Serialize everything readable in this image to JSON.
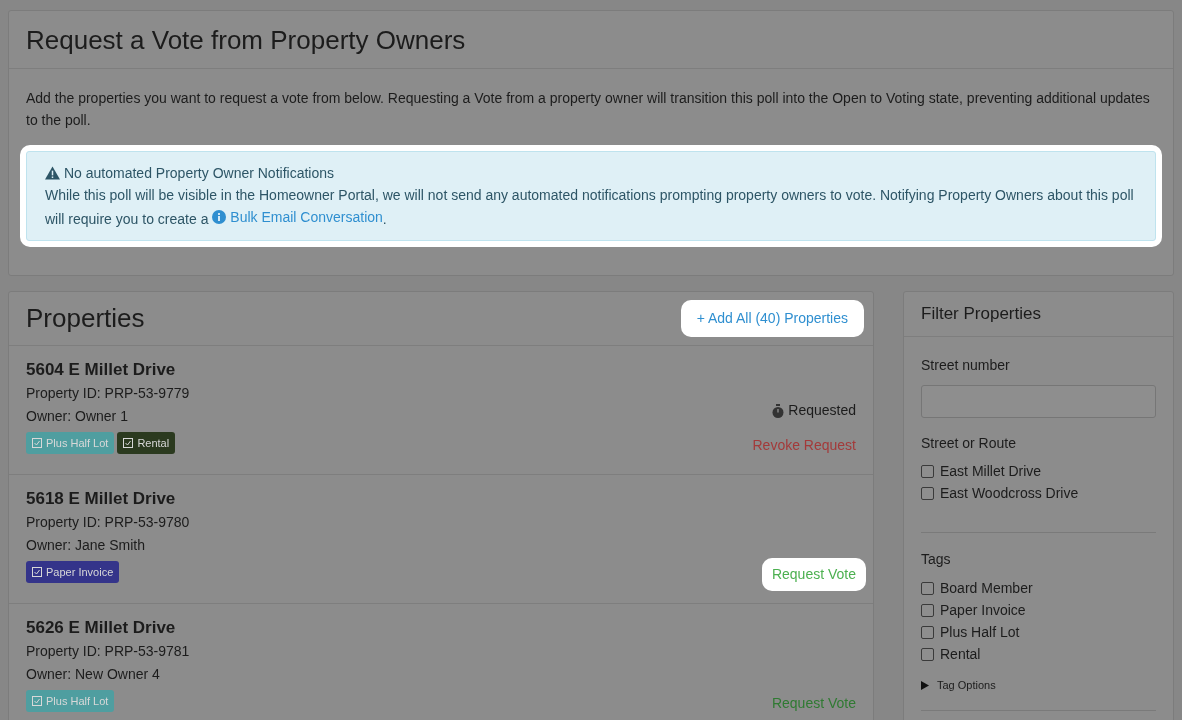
{
  "header": {
    "title": "Request a Vote from Property Owners",
    "description": "Add the properties you want to request a vote from below. Requesting a Vote from a property owner will transition this poll into the Open to Voting state, preventing additional updates to the poll."
  },
  "alert": {
    "highlighted": true,
    "title": "No automated Property Owner Notifications",
    "text": "While this poll will be visible in the Homeowner Portal, we will not send any automated notifications prompting property owners to vote. Notifying Property Owners about this poll will require you to create a",
    "link": "Bulk Email Conversation",
    "after": "."
  },
  "properties": {
    "title": "Properties",
    "add_all": {
      "label": "+ Add All (40) Properties",
      "highlighted": true
    },
    "rows": [
      {
        "address": "5604 E Millet Drive",
        "property_id": "Property ID: PRP-53-9779",
        "owner": "Owner: Owner 1",
        "tags": [
          {
            "label": "Plus Half Lot",
            "color": "#4f9ea0"
          },
          {
            "label": "Rental",
            "color": "#2b3a1f"
          }
        ],
        "kind": "requested",
        "status": "Requested",
        "action": "Revoke Request",
        "highlighted": false
      },
      {
        "address": "5618 E Millet Drive",
        "property_id": "Property ID: PRP-53-9780",
        "owner": "Owner: Jane Smith",
        "tags": [
          {
            "label": "Paper Invoice",
            "color": "#34348a"
          }
        ],
        "kind": "request",
        "action": "Request Vote",
        "highlighted": true
      },
      {
        "address": "5626 E Millet Drive",
        "property_id": "Property ID: PRP-53-9781",
        "owner": "Owner: New Owner 4",
        "tags": [
          {
            "label": "Plus Half Lot",
            "color": "#4f9ea0"
          }
        ],
        "kind": "request",
        "action": "Request Vote",
        "highlighted": false
      }
    ]
  },
  "filter": {
    "title": "Filter Properties",
    "street_number": {
      "label": "Street number"
    },
    "street": {
      "label": "Street or Route",
      "options": [
        {
          "label": "East Millet Drive",
          "checked": false
        },
        {
          "label": "East Woodcross Drive",
          "checked": false
        }
      ]
    },
    "tags": {
      "label": "Tags",
      "options": [
        {
          "label": "Board Member",
          "checked": false
        },
        {
          "label": "Paper Invoice",
          "checked": false
        },
        {
          "label": "Plus Half Lot",
          "checked": false
        },
        {
          "label": "Rental",
          "checked": false
        }
      ]
    },
    "tag_options": {
      "label": "Tag Options",
      "expanded": false
    }
  }
}
